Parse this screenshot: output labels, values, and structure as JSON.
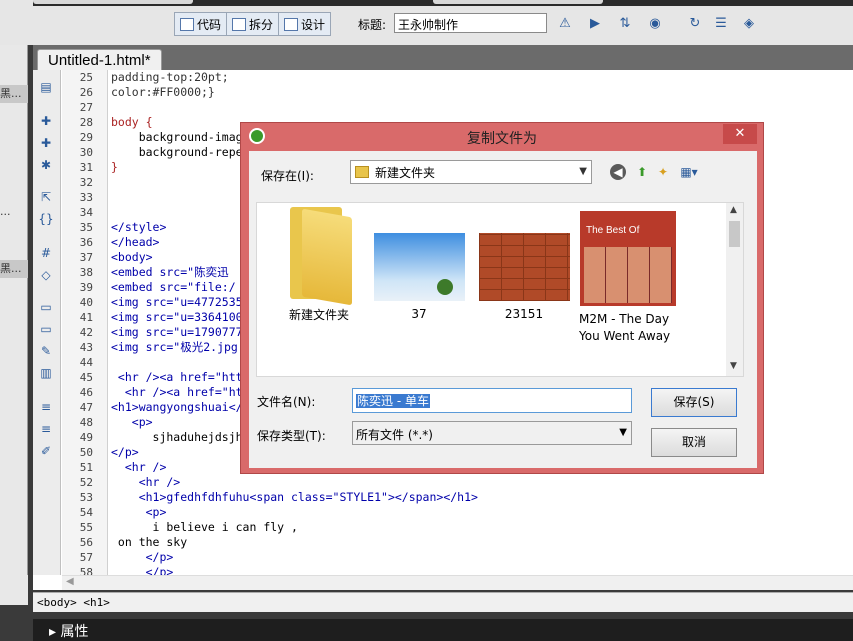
{
  "toolbar": {
    "code_label": "代码",
    "split_label": "拆分",
    "design_label": "设计",
    "title_label": "标题:",
    "title_value": "王永帅制作"
  },
  "left_panel": {
    "rows": [
      "黑...",
      "...",
      "黑..."
    ]
  },
  "document": {
    "tab_label": "Untitled-1.html*"
  },
  "code_lines": [
    {
      "n": "25",
      "text": "padding-top:20pt;",
      "cls": "c-default"
    },
    {
      "n": "26",
      "text": "color:#FF0000;}",
      "cls": "c-default"
    },
    {
      "n": "27",
      "text": "",
      "cls": "c-default"
    },
    {
      "n": "28",
      "text": "body {",
      "cls": "c-css"
    },
    {
      "n": "29",
      "text": "    background-imag",
      "cls": "c-plain"
    },
    {
      "n": "30",
      "text": "    background-repe",
      "cls": "c-plain"
    },
    {
      "n": "31",
      "text": "}",
      "cls": "c-css"
    },
    {
      "n": "32",
      "text": "",
      "cls": "c-default"
    },
    {
      "n": "33",
      "text": "",
      "cls": "c-default"
    },
    {
      "n": "34",
      "text": "",
      "cls": "c-default"
    },
    {
      "n": "35",
      "text": "</style>",
      "cls": "c-tag"
    },
    {
      "n": "36",
      "text": "</head>",
      "cls": "c-tag"
    },
    {
      "n": "37",
      "text": "<body>",
      "cls": "c-tag"
    },
    {
      "n": "38",
      "text": "<embed src=\"陈奕迅",
      "cls": "c-tag"
    },
    {
      "n": "39",
      "text": "<embed src=\"file:/",
      "cls": "c-tag"
    },
    {
      "n": "40",
      "text": "<img src=\"u=4772535",
      "cls": "c-tag"
    },
    {
      "n": "41",
      "text": "<img src=\"u=3364100",
      "cls": "c-tag"
    },
    {
      "n": "42",
      "text": "<img src=\"u=1790777",
      "cls": "c-tag"
    },
    {
      "n": "43",
      "text": "<img src=\"极光2.jpg",
      "cls": "c-tag"
    },
    {
      "n": "44",
      "text": "",
      "cls": "c-default"
    },
    {
      "n": "45",
      "text": " <hr /><a href=\"htt",
      "cls": "c-tag"
    },
    {
      "n": "46",
      "text": "  <hr /><a href=\"ht",
      "cls": "c-tag"
    },
    {
      "n": "47",
      "text": "<h1>wangyongshuai</",
      "cls": "c-tag"
    },
    {
      "n": "48",
      "text": "   <p>",
      "cls": "c-tag"
    },
    {
      "n": "49",
      "text": "      sjhaduhejdsjh",
      "cls": "c-plain"
    },
    {
      "n": "50",
      "text": "</p>",
      "cls": "c-tag"
    },
    {
      "n": "51",
      "text": "  <hr />",
      "cls": "c-tag"
    },
    {
      "n": "52",
      "text": "    <hr />",
      "cls": "c-tag"
    },
    {
      "n": "53",
      "text": "    <h1>gfedhfdhfuhu<span class=\"STYLE1\"></span></h1>",
      "cls": "c-tag"
    },
    {
      "n": "54",
      "text": "     <p>",
      "cls": "c-tag"
    },
    {
      "n": "55",
      "text": "      i believe i can fly ,",
      "cls": "c-plain"
    },
    {
      "n": "56",
      "text": " on the sky",
      "cls": "c-plain"
    },
    {
      "n": "57",
      "text": "     </p>",
      "cls": "c-tag"
    },
    {
      "n": "58",
      "text": "     </p>",
      "cls": "c-tag"
    }
  ],
  "status": {
    "tag_path": "<body> <h1>"
  },
  "properties": {
    "label": "属性"
  },
  "dialog": {
    "title": "复制文件为",
    "close_glyph": "✕",
    "save_in_label": "保存在(I):",
    "save_in_value": "新建文件夹",
    "files": [
      {
        "name": "新建文件夹",
        "kind": "folder"
      },
      {
        "name": "37",
        "kind": "sky"
      },
      {
        "name": "23151",
        "kind": "brick"
      },
      {
        "name": "M2M - The Day You Went Away",
        "kind": "album",
        "album_text": "The Best Of"
      }
    ],
    "filename_label": "文件名(N):",
    "filename_value": "陈奕迅 - 单车",
    "filetype_label": "保存类型(T):",
    "filetype_value": "所有文件 (*.*)",
    "save_button": "保存(S)",
    "cancel_button": "取消"
  },
  "colors": {
    "dialog_frame": "#d96a6a",
    "tag_color": "#0000aa",
    "css_color": "#aa2222"
  }
}
